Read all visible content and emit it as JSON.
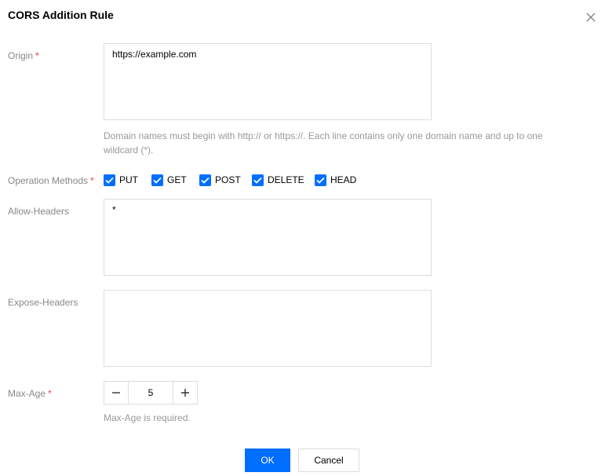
{
  "dialog": {
    "title": "CORS Addition Rule"
  },
  "form": {
    "origin": {
      "label": "Origin",
      "required_mark": "*",
      "value": "https://example.com",
      "help_line1": "Domain names must begin with http:// or https://. Each line contains only one domain name and up to one",
      "help_line2": "wildcard (*)."
    },
    "methods": {
      "label": "Operation Methods",
      "required_mark": "*",
      "options": [
        {
          "label": "PUT",
          "checked": true
        },
        {
          "label": "GET",
          "checked": true
        },
        {
          "label": "POST",
          "checked": true
        },
        {
          "label": "DELETE",
          "checked": true
        },
        {
          "label": "HEAD",
          "checked": true
        }
      ]
    },
    "allow_headers": {
      "label": "Allow-Headers",
      "value": "*"
    },
    "expose_headers": {
      "label": "Expose-Headers",
      "value": ""
    },
    "max_age": {
      "label": "Max-Age",
      "required_mark": "*",
      "value": "5",
      "help": "Max-Age is required."
    }
  },
  "footer": {
    "ok_label": "OK",
    "cancel_label": "Cancel"
  },
  "icons": {
    "close": "close-icon",
    "check": "check-icon",
    "minus": "minus-icon",
    "plus": "plus-icon"
  },
  "colors": {
    "accent": "#006eff",
    "required": "#e54545",
    "label": "#888888",
    "help": "#999999",
    "border": "#dddddd"
  }
}
